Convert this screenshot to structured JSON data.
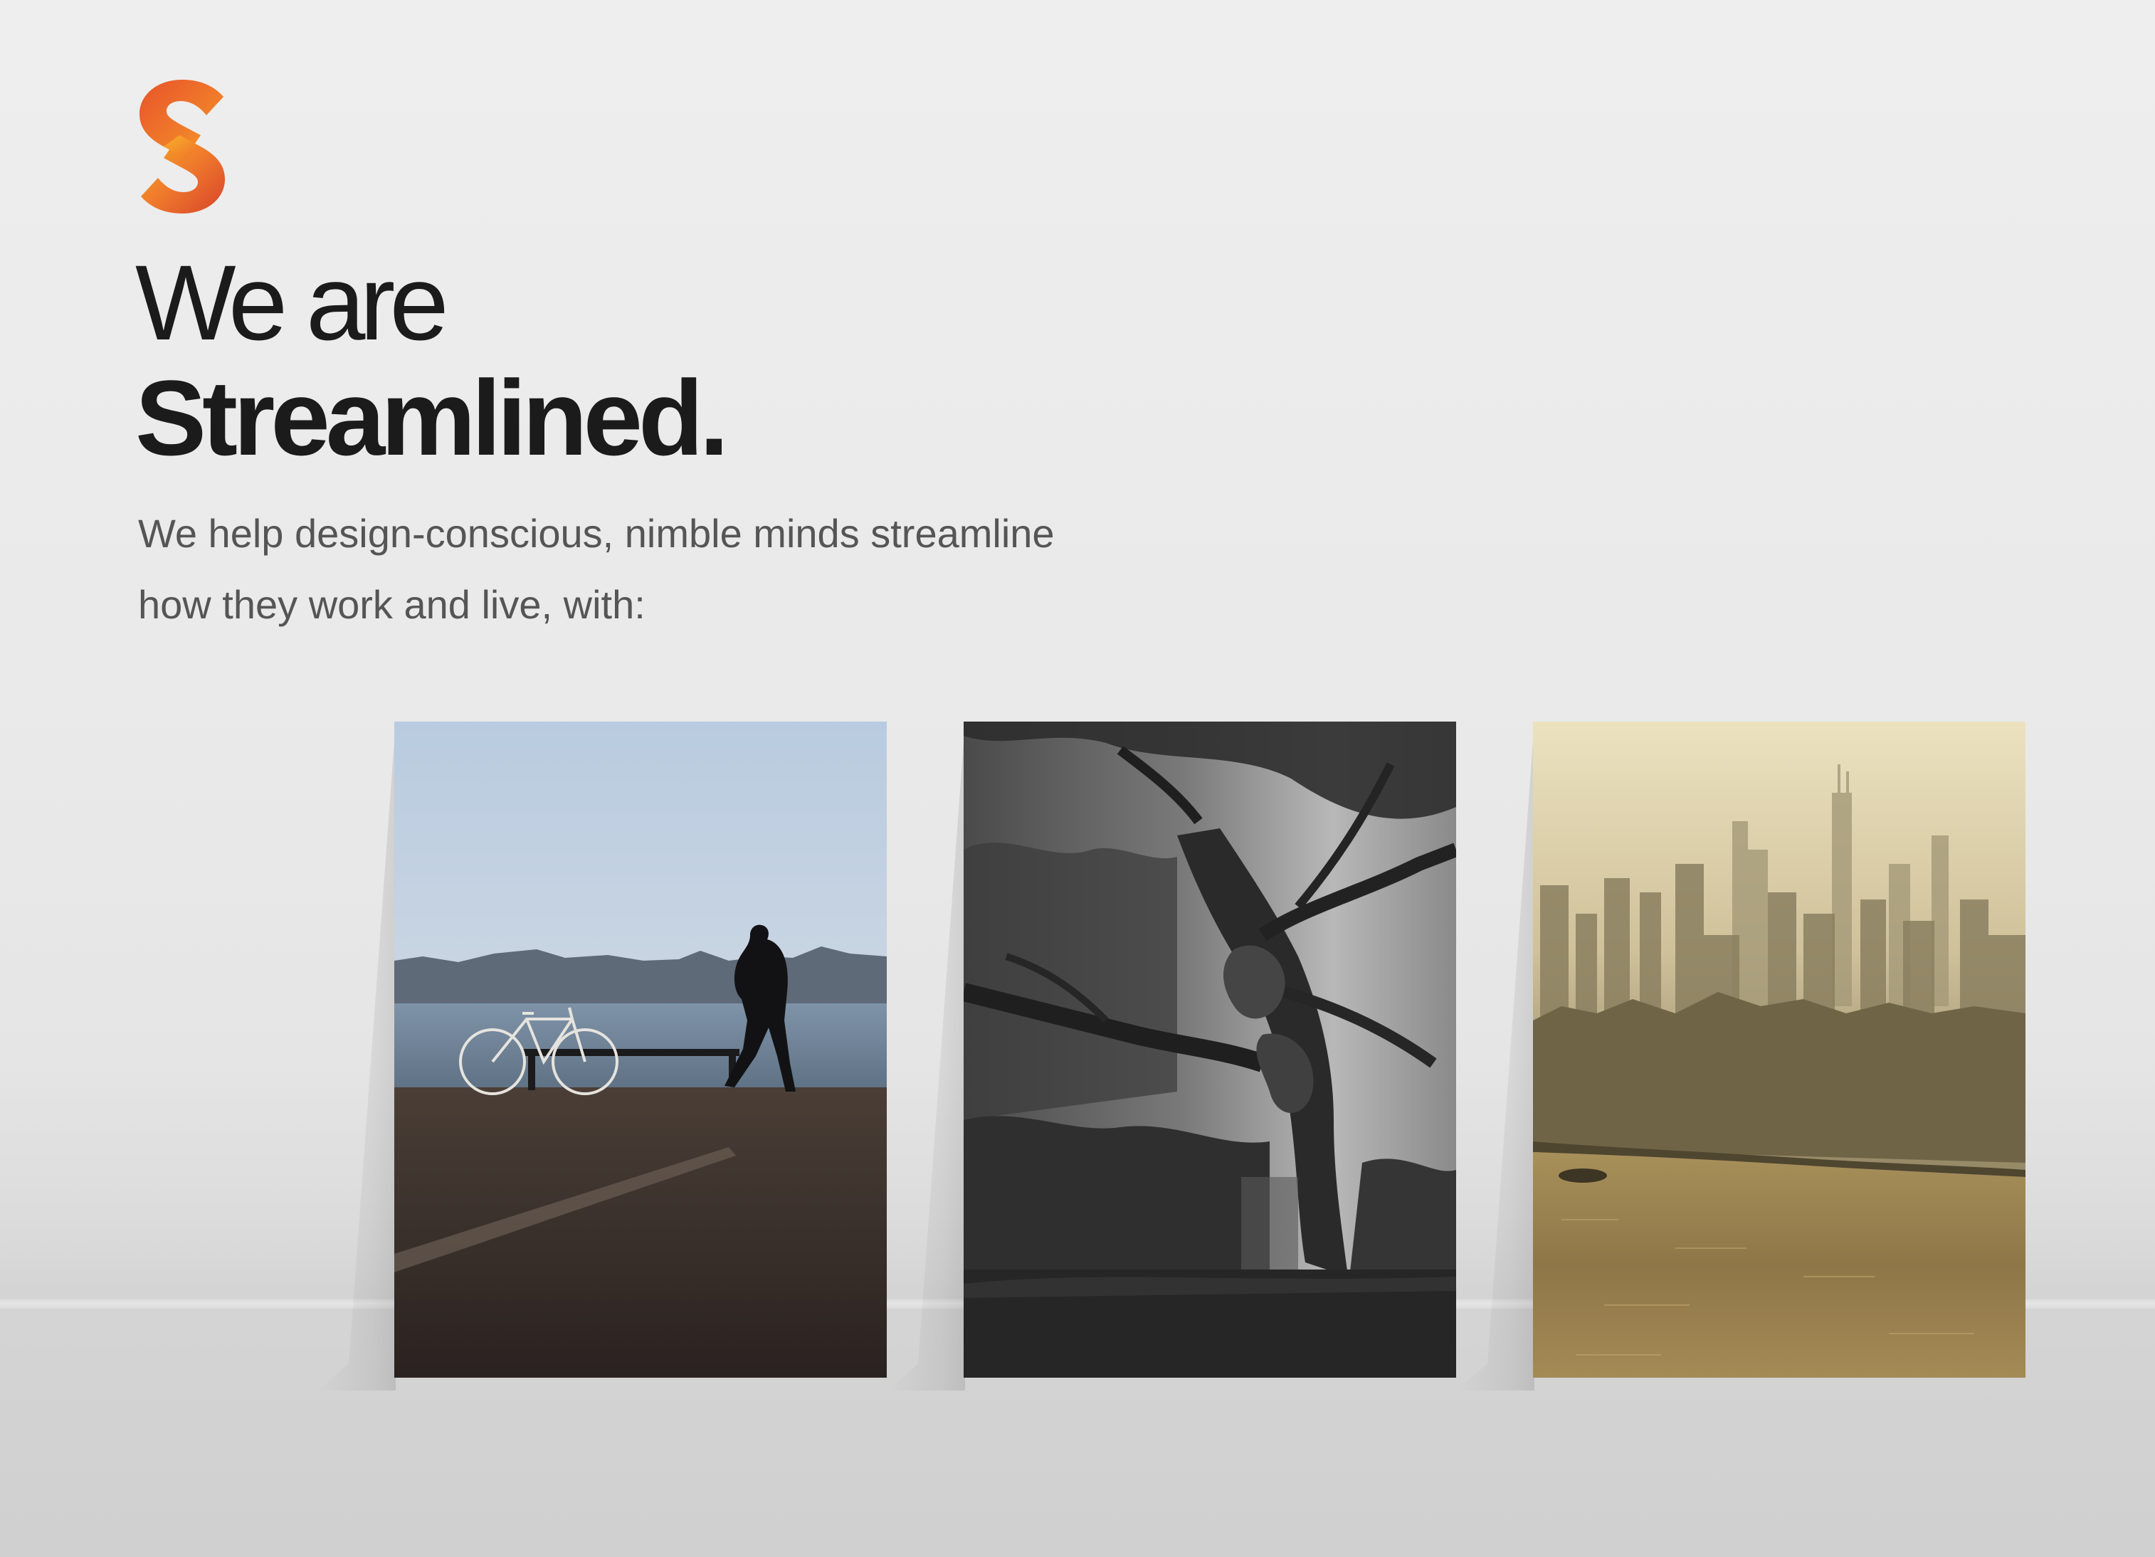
{
  "hero": {
    "logo_icon": "streamlined-s-logo-icon",
    "headline_light": "We are",
    "headline_bold": "Streamlined.",
    "subtitle_line1": "We help design-conscious, nimble minds streamline",
    "subtitle_line2": "how they work and live, with:"
  },
  "gallery": {
    "items": [
      {
        "name": "photo-seaside-bicycle"
      },
      {
        "name": "photo-foggy-tree"
      },
      {
        "name": "photo-hazy-city-skyline"
      }
    ]
  },
  "colors": {
    "logo_gradient_top": "#ef7a2c",
    "logo_gradient_bottom": "#e04a2a",
    "logo_gradient_mid": "#f5a623",
    "headline": "#1b1b1b",
    "subtitle": "#555555",
    "background": "#ebebeb"
  }
}
